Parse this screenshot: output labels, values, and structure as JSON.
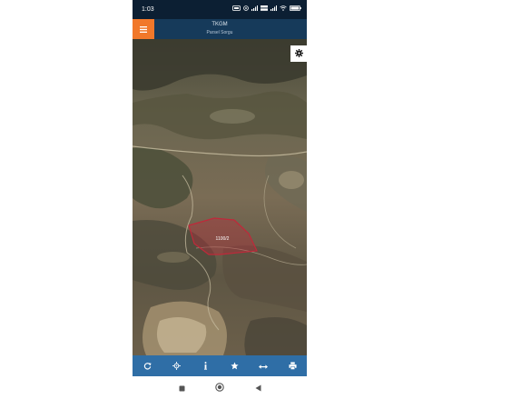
{
  "status_bar": {
    "time": "1:03",
    "icons": [
      "sim-card-icon",
      "whatsapp-icon",
      "signal-icon",
      "volte-icon",
      "signal-icon",
      "wifi-icon",
      "battery-icon"
    ],
    "battery_level": "100"
  },
  "header": {
    "title": "TKGM",
    "subtitle": "Parsel Sorgu",
    "menu_icon": "hamburger-menu-icon",
    "accent_color": "#f1782a",
    "bg_color": "#163a5a"
  },
  "map": {
    "settings_icon": "gear-icon",
    "parcel_label": "1100/2",
    "parcel_color": "#c0283a"
  },
  "toolbar": {
    "bg_color": "#2f6ea6",
    "buttons": [
      {
        "name": "refresh",
        "icon": "refresh-icon"
      },
      {
        "name": "locate",
        "icon": "crosshair-icon"
      },
      {
        "name": "info",
        "icon": "info-icon"
      },
      {
        "name": "favorites",
        "icon": "star-icon"
      },
      {
        "name": "measure",
        "icon": "arrows-horizontal-icon"
      },
      {
        "name": "print",
        "icon": "print-icon"
      }
    ]
  },
  "nav_bar": {
    "buttons": [
      "recents-square-icon",
      "home-circle-icon",
      "back-triangle-icon"
    ]
  }
}
